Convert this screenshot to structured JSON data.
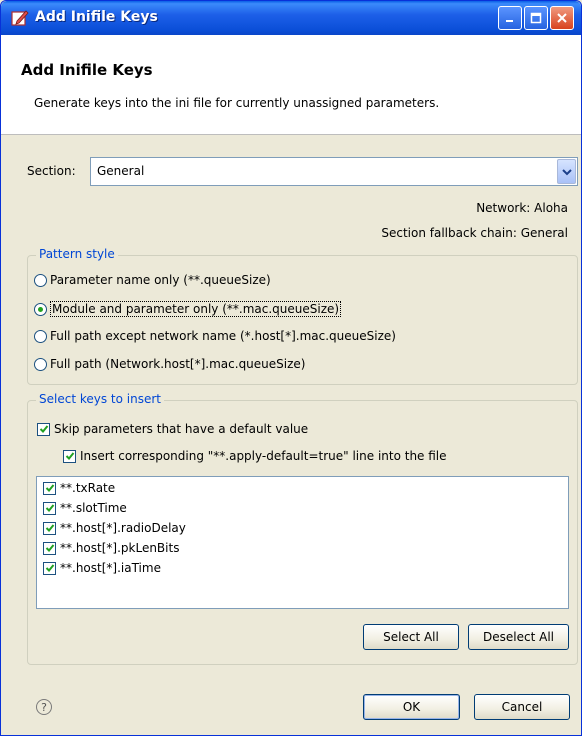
{
  "window": {
    "title": "Add Inifile Keys"
  },
  "header": {
    "title": "Add Inifile Keys",
    "description": "Generate keys into the ini file for currently unassigned parameters."
  },
  "section": {
    "label": "Section:",
    "value": "General"
  },
  "info": {
    "network": "Network: Aloha",
    "fallback_chain": "Section fallback chain: General"
  },
  "pattern_style": {
    "title": "Pattern style",
    "options": [
      {
        "label": "Parameter name only (**.queueSize)",
        "selected": false
      },
      {
        "label": "Module and parameter only (**.mac.queueSize)",
        "selected": true
      },
      {
        "label": "Full path except network name (*.host[*].mac.queueSize)",
        "selected": false
      },
      {
        "label": "Full path (Network.host[*].mac.queueSize)",
        "selected": false
      }
    ]
  },
  "select_keys": {
    "title": "Select keys to insert",
    "skip_default": {
      "label": "Skip parameters that have a default value",
      "checked": true
    },
    "insert_apply_default": {
      "label": "Insert corresponding \"**.apply-default=true\" line into the file",
      "checked": true
    },
    "keys": [
      {
        "label": "**.txRate",
        "checked": true
      },
      {
        "label": "**.slotTime",
        "checked": true
      },
      {
        "label": "**.host[*].radioDelay",
        "checked": true
      },
      {
        "label": "**.host[*].pkLenBits",
        "checked": true
      },
      {
        "label": "**.host[*].iaTime",
        "checked": true
      }
    ],
    "select_all_label": "Select All",
    "deselect_all_label": "Deselect All"
  },
  "footer": {
    "help_symbol": "?",
    "ok_label": "OK",
    "cancel_label": "Cancel"
  },
  "colors": {
    "titlebar": "#0b4fd8",
    "group_title": "#0046d5",
    "check": "#21a121"
  }
}
